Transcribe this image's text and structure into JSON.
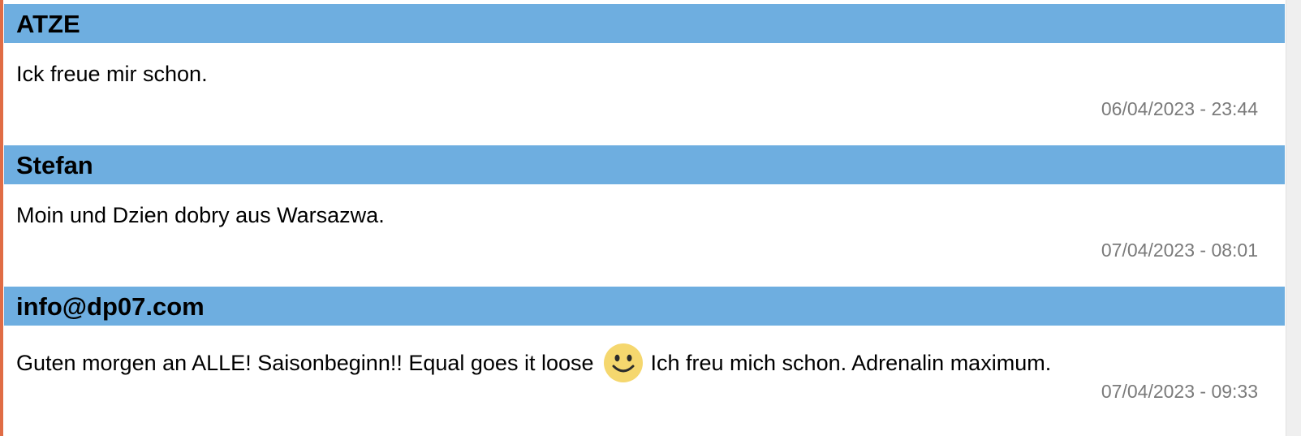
{
  "comments": [
    {
      "author": "ATZE",
      "text": "Ick freue mir schon.",
      "timestamp": "06/04/2023 - 23:44"
    },
    {
      "author": "Stefan",
      "text": "Moin und Dzien dobry aus Warsazwa.",
      "timestamp": "07/04/2023 - 08:01"
    },
    {
      "author": "info@dp07.com",
      "text_before_emoji": "Guten morgen an ALLE! Saisonbeginn!! Equal goes it loose",
      "emoji": "smiley-icon",
      "text_after_emoji": "Ich freu mich schon. Adrenalin maximum.",
      "timestamp": "07/04/2023 - 09:33"
    }
  ],
  "colors": {
    "header_bg": "#6eaee0",
    "left_border": "#e06c45",
    "timestamp": "#7a7a7a",
    "emoji_face": "#f5d76e"
  }
}
